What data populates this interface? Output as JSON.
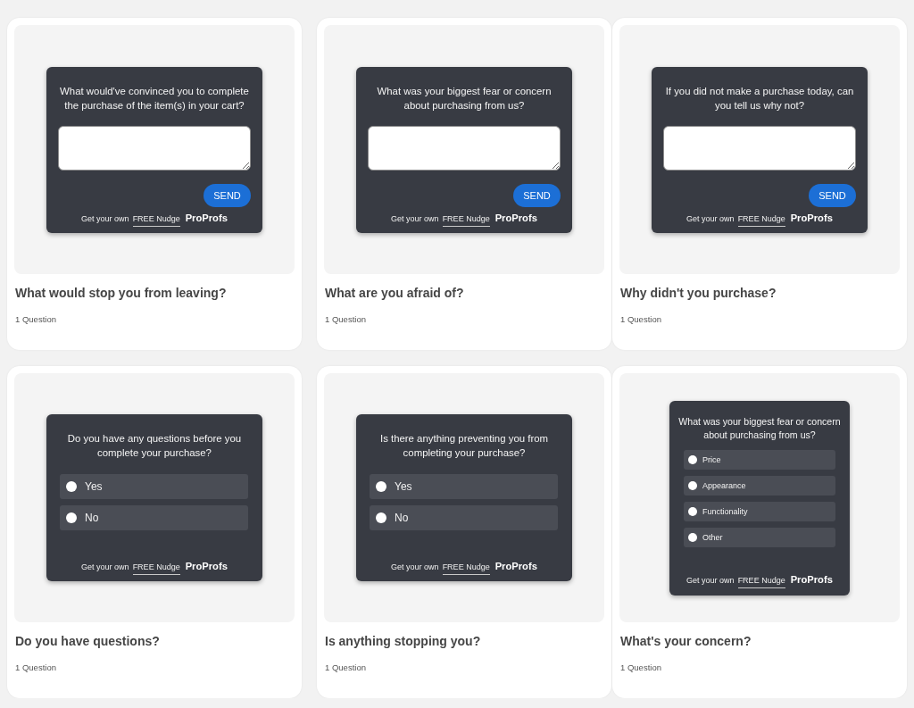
{
  "cards": [
    {
      "title": "What would stop you from leaving?",
      "meta": "1 Question",
      "preview": {
        "kind": "text",
        "question": "What would've convinced you to complete the purchase of the item(s) in your cart?",
        "button": "SEND",
        "footer": {
          "text": "Get your own",
          "link": "FREE Nudge",
          "brand": "ProProfs"
        }
      }
    },
    {
      "title": "What are you afraid of?",
      "meta": "1 Question",
      "preview": {
        "kind": "text",
        "question": "What was your biggest fear or concern about purchasing from us?",
        "button": "SEND",
        "footer": {
          "text": "Get your own",
          "link": "FREE Nudge",
          "brand": "ProProfs"
        }
      }
    },
    {
      "title": "Why didn't you purchase?",
      "meta": "1 Question",
      "preview": {
        "kind": "text",
        "question": "If you did not make a purchase today, can you tell us why not?",
        "button": "SEND",
        "footer": {
          "text": "Get your own",
          "link": "FREE Nudge",
          "brand": "ProProfs"
        }
      }
    },
    {
      "title": "Do you have questions?",
      "meta": "1 Question",
      "preview": {
        "kind": "choice",
        "question": "Do you have any questions before you complete your purchase?",
        "options": [
          {
            "label": "Yes",
            "selected": false
          },
          {
            "label": "No",
            "selected": false
          }
        ],
        "footer": {
          "text": "Get your own",
          "link": "FREE Nudge",
          "brand": "ProProfs"
        }
      }
    },
    {
      "title": "Is anything stopping you?",
      "meta": "1 Question",
      "preview": {
        "kind": "choice",
        "question": "Is there anything preventing you from completing your purchase?",
        "options": [
          {
            "label": "Yes",
            "selected": false
          },
          {
            "label": "No",
            "selected": false
          }
        ],
        "footer": {
          "text": "Get your own",
          "link": "FREE Nudge",
          "brand": "ProProfs"
        }
      }
    },
    {
      "title": "What's your concern?",
      "meta": "1 Question",
      "preview": {
        "kind": "choice",
        "question": "What was your biggest fear or concern about purchasing from us?",
        "options": [
          {
            "label": "Price",
            "selected": false
          },
          {
            "label": "Appearance",
            "selected": false
          },
          {
            "label": "Functionality",
            "selected": false
          },
          {
            "label": "Other",
            "selected": false
          }
        ],
        "footer": {
          "text": "Get your own",
          "link": "FREE Nudge",
          "brand": "ProProfs"
        }
      }
    }
  ]
}
